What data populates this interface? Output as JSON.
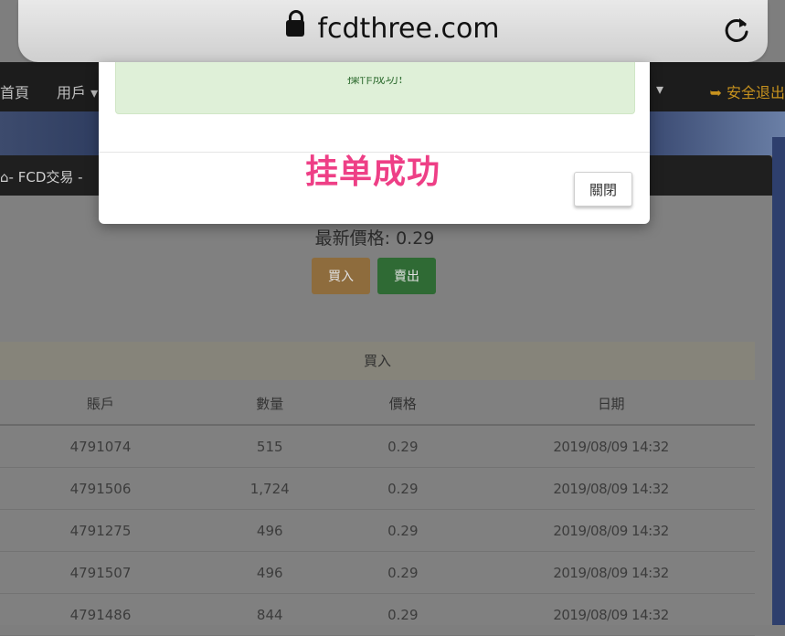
{
  "browser": {
    "url": "fcdthree.com"
  },
  "navbar": {
    "home": "首頁",
    "user": "用戶",
    "logout": "安全退出"
  },
  "breadcrumb": "- FCD交易 -",
  "modal": {
    "alert_text": "操作成功!",
    "close_label": "關閉"
  },
  "caption": "挂单成功",
  "trade": {
    "latest_price_label": "最新價格: 0.29",
    "buy_label": "買入",
    "sell_label": "賣出"
  },
  "buy_orders": {
    "section_title": "買入",
    "columns": [
      "賬戶",
      "數量",
      "價格",
      "日期"
    ],
    "rows": [
      [
        "4791074",
        "515",
        "0.29",
        "2019/08/09 14:32"
      ],
      [
        "4791506",
        "1,724",
        "0.29",
        "2019/08/09 14:32"
      ],
      [
        "4791275",
        "496",
        "0.29",
        "2019/08/09 14:32"
      ],
      [
        "4791507",
        "496",
        "0.29",
        "2019/08/09 14:32"
      ],
      [
        "4791486",
        "844",
        "0.29",
        "2019/08/09 14:32"
      ]
    ]
  },
  "colors": {
    "caption": "#ee3f86",
    "alert_bg": "#dff0d8",
    "alert_text": "#3c763d"
  }
}
